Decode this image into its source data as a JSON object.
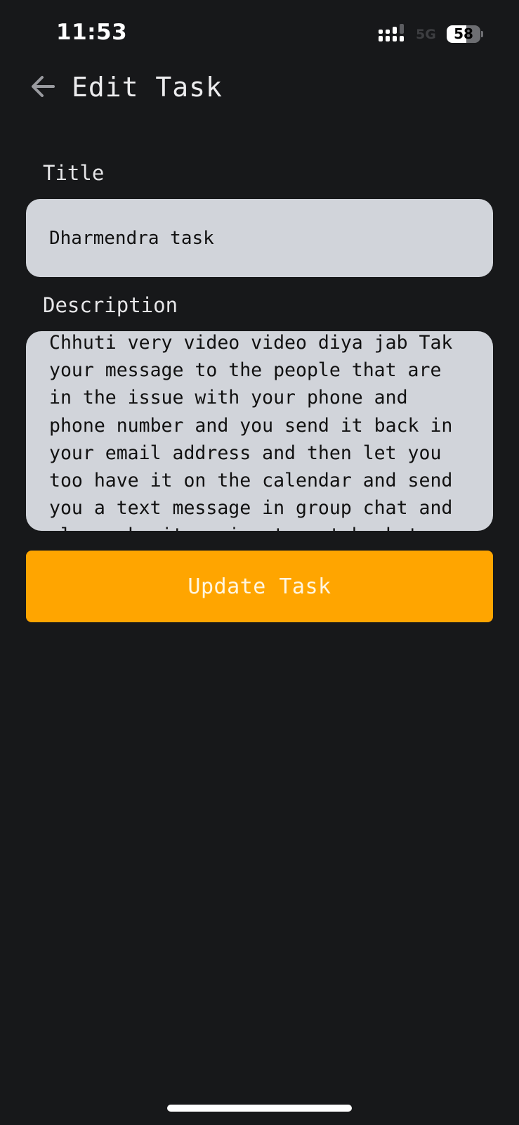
{
  "status_bar": {
    "time": "11:53",
    "network": "5G",
    "battery_level": "58",
    "battery_fraction": 0.58
  },
  "header": {
    "title": "Edit Task",
    "back_icon": "arrow-left-icon"
  },
  "form": {
    "title_label": "Title",
    "title_value": "Dharmendra task",
    "description_label": "Description",
    "description_value": "Chhuti very video video diya jab Tak\nyour message to the people that are\nin the issue with your phone and\nphone number and you send it back in\nyour email address and then let you\ntoo have it on the calendar and send\nyou a text message in group chat and\nalso make it easier to get back to"
  },
  "actions": {
    "update_label": "Update Task"
  },
  "colors": {
    "background": "#17181a",
    "input_background": "#d1d4da",
    "accent": "#ffa500"
  }
}
